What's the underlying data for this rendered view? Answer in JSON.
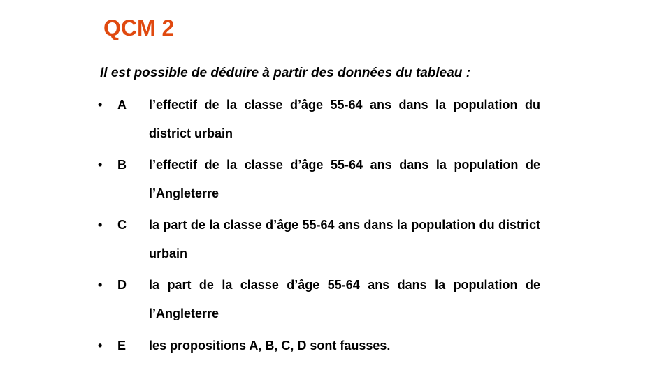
{
  "slide": {
    "title": "QCM 2",
    "title_color": "#E0490F",
    "intro": "Il est possible de déduire à partir des données du tableau :",
    "bullet": "•",
    "options": [
      {
        "letter": "A",
        "text": "l’effectif de la classe d’âge 55-64 ans dans la population du district urbain"
      },
      {
        "letter": "B",
        "text": "l’effectif de la classe d’âge 55-64 ans dans la population de l’Angleterre"
      },
      {
        "letter": "C",
        "text": "la part de la classe d’âge 55-64 ans dans la population du district urbain"
      },
      {
        "letter": "D",
        "text": "la part de la classe d’âge 55-64 ans dans la population de l’Angleterre"
      },
      {
        "letter": "E",
        "text": "les propositions A, B, C, D sont fausses."
      }
    ]
  }
}
